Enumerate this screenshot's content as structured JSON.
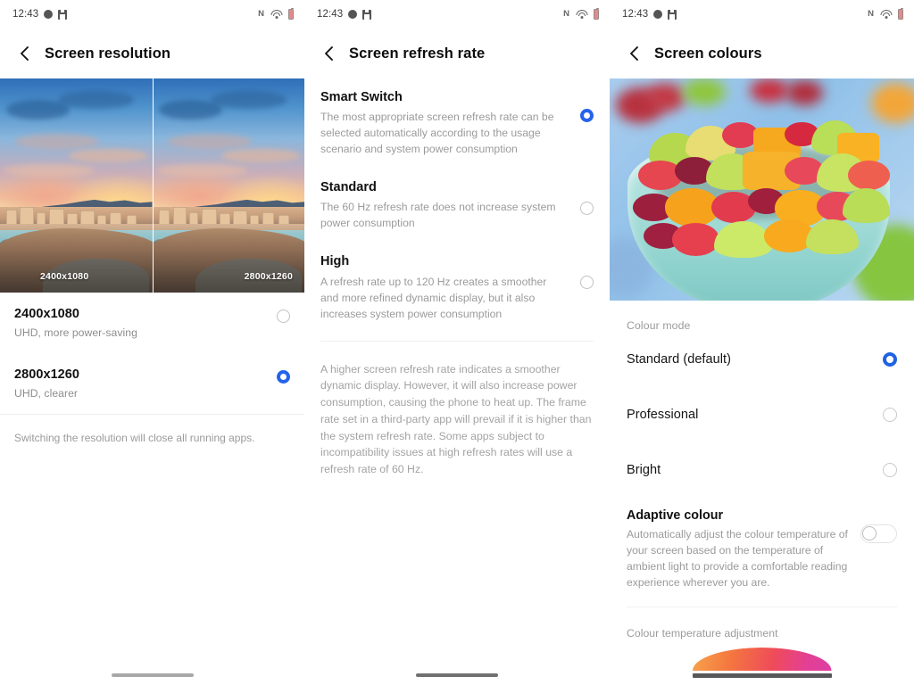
{
  "status_bar": {
    "time": "12:43",
    "left_icons": [
      "message-dot-icon",
      "save-icon"
    ],
    "right_icons": [
      "nfc-icon",
      "wifi-icon",
      "battery-icon"
    ],
    "nfc_label": "N"
  },
  "panels": [
    {
      "id": "screen-resolution",
      "title": "Screen resolution",
      "back_icon": "back-chevron-icon",
      "preview": {
        "left_label": "2400x1080",
        "right_label": "2800x1260",
        "image_description": "seascape-sunset-photo"
      },
      "options": [
        {
          "title": "2400x1080",
          "subtitle": "UHD, more power-saving",
          "selected": false
        },
        {
          "title": "2800x1260",
          "subtitle": "UHD, clearer",
          "selected": true
        }
      ],
      "note": "Switching the resolution will close all running apps."
    },
    {
      "id": "screen-refresh-rate",
      "title": "Screen refresh rate",
      "back_icon": "back-chevron-icon",
      "options": [
        {
          "title": "Smart Switch",
          "description": "The most appropriate screen refresh rate can be selected automatically according to the usage scenario and system power consumption",
          "selected": true
        },
        {
          "title": "Standard",
          "description": "The 60 Hz refresh rate does not increase system power consumption",
          "selected": false
        },
        {
          "title": "High",
          "description": "A refresh rate up to 120 Hz creates a smoother and more refined dynamic display, but it also increases system power consumption",
          "selected": false
        }
      ],
      "footnote": "A higher screen refresh rate indicates a smoother dynamic display. However, it will also increase power consumption, causing the phone to heat up. The frame rate set in a third-party app will prevail if it is higher than the system refresh rate. Some apps subject to incompatibility issues at high refresh rates will use a refresh rate of 60 Hz."
    },
    {
      "id": "screen-colours",
      "title": "Screen colours",
      "back_icon": "back-chevron-icon",
      "preview": {
        "image_description": "fruit-salad-bowl-photo"
      },
      "section_label": "Colour mode",
      "modes": [
        {
          "label": "Standard (default)",
          "selected": true
        },
        {
          "label": "Professional",
          "selected": false
        },
        {
          "label": "Bright",
          "selected": false
        }
      ],
      "adaptive": {
        "title": "Adaptive colour",
        "description": "Automatically adjust the colour temperature of your screen based on the temperature of ambient light to provide a comfortable reading experience wherever you are.",
        "enabled": false
      },
      "temperature_label": "Colour temperature adjustment"
    }
  ],
  "colors": {
    "accent_blue": "#2563eb",
    "accent_blue_alt": "#1f63e0",
    "title_text": "#111111",
    "secondary_text": "#9b9b9b",
    "divider": "#f0f0f0",
    "background": "#ffffff"
  }
}
